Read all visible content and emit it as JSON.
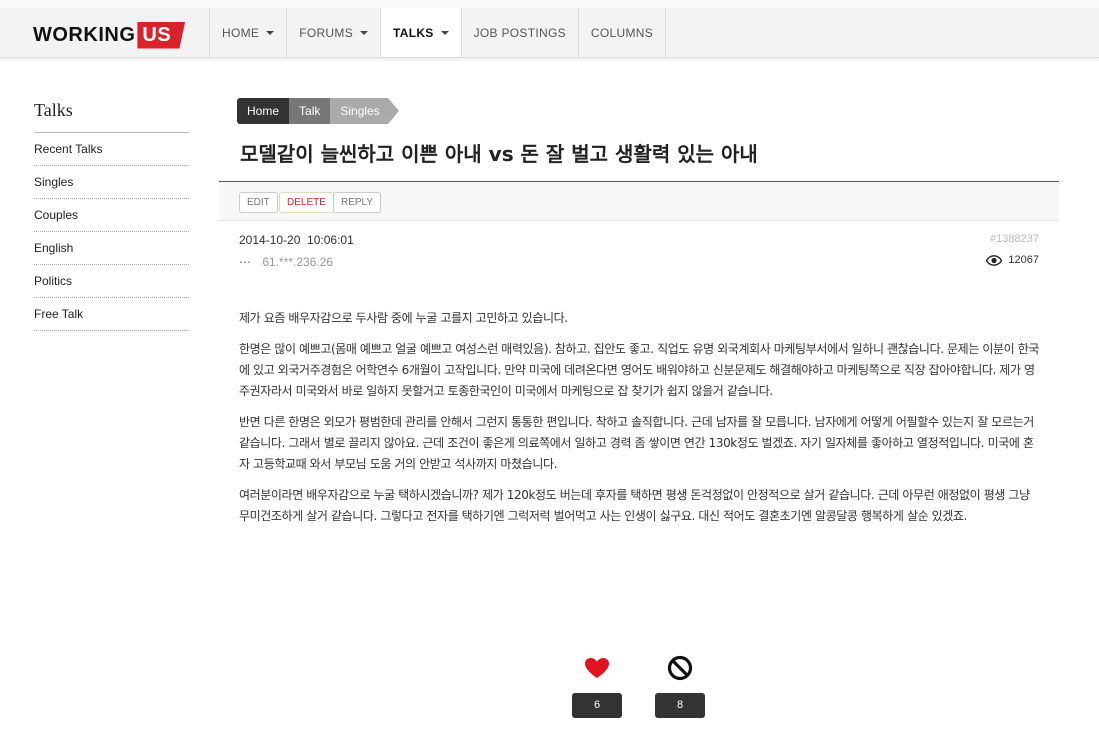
{
  "header": {
    "logo_part1": "WORKING",
    "logo_part2": "US",
    "brand_color": "#d8232a",
    "nav": [
      {
        "label": "HOME",
        "dropdown": true
      },
      {
        "label": "FORUMS",
        "dropdown": true
      },
      {
        "label": "TALKS",
        "dropdown": true,
        "active": true
      },
      {
        "label": "JOB POSTINGS",
        "dropdown": false
      },
      {
        "label": "COLUMNS",
        "dropdown": false
      }
    ]
  },
  "sidebar": {
    "title": "Talks",
    "items": [
      {
        "label": "Recent Talks"
      },
      {
        "label": "Singles"
      },
      {
        "label": "Couples"
      },
      {
        "label": "English"
      },
      {
        "label": "Politics"
      },
      {
        "label": "Free Talk"
      }
    ]
  },
  "breadcrumb": {
    "home": "Home",
    "talk": "Talk",
    "singles": "Singles"
  },
  "post": {
    "title": "모델같이 늘씬하고 이쁜 아내 vs 돈 잘 벌고 생활력 있는 아내",
    "actions": {
      "edit": "EDIT",
      "delete": "DELETE",
      "reply": "REPLY"
    },
    "date": "2014-10-20  10:06:01",
    "ip": "61.***.236.26",
    "id": "#1388237",
    "views": "12067",
    "paragraphs": [
      "제가 요즘 배우자감으로 두사람 중에 누굴 고를지 고민하고 있습니다.",
      "한명은 많이 예쁘고(몸매 예쁘고 얼굴 예쁘고 여성스런 매력있음). 참하고. 집안도 좋고. 직업도 유명 외국계회사 마케팅부서에서 일하니 괜찮습니다. 문제는 이분이 한국에 있고 외국거주경험은 어학연수 6개월이 고작입니다. 만약 미국에 데려온다면 영어도 배워야하고 신분문제도 해결해야하고 마케팅쪽으로 직장 잡아야합니다. 제가 영주권자라서 미국와서 바로 일하지 못할거고 토종한국인이 미국에서 마케팅으로 잡 찾기가 쉽지 않을거 같습니다.",
      "반면 다른 한명은 외모가 평범한데 관리를 안해서 그런지 통통한 편입니다. 착하고 솔직합니다. 근데 남자를 잘 모릅니다. 남자에게 어떻게 어필할수 있는지 잘 모르는거 같습니다. 그래서 별로 끌리지 않아요. 근데 조건이 좋은게 의료쪽에서 일하고 경력 좀 쌓이면 연간 130k정도 벌겠죠. 자기 일자체를 좋아하고 열정적입니다. 미국에 혼자 고등학교때 와서 부모님 도움 거의 안받고 석사까지 마쳤습니다.",
      "여러분이라면 배우자감으로 누굴 택하시겠습니까? 제가 120k정도 버는데 후자를 택하면 평생 돈걱정없이 안정적으로 살거 같습니다. 근데 아무런 애정없이 평생 그냥 무미건조하게 살거 같습니다. 그렇다고 전자를 택하기엔 그럭저럭 벌어먹고 사는 인생이 싫구요. 대신 적어도 결혼초기엔 알콩달콩 행복하게 살순 있겠죠."
    ]
  },
  "votes": {
    "like_icon": "heart-icon",
    "like_count": "6",
    "like_color": "#e0141e",
    "dislike_icon": "ban-icon",
    "dislike_count": "8"
  }
}
